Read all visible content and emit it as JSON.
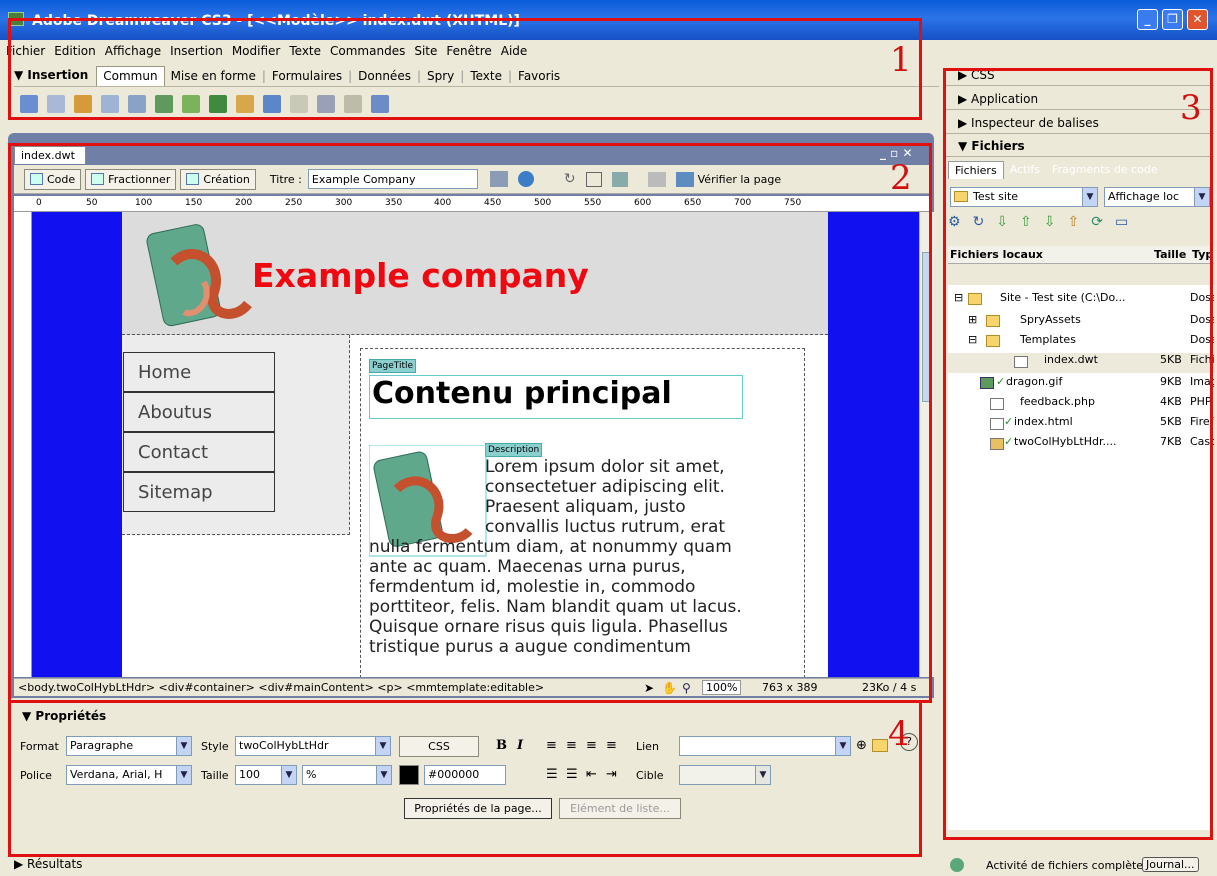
{
  "window": {
    "title": "Adobe Dreamweaver CS3 - [<<Modèle>> index.dwt (XHTML)]"
  },
  "menu": [
    "Fichier",
    "Edition",
    "Affichage",
    "Insertion",
    "Modifier",
    "Texte",
    "Commandes",
    "Site",
    "Fenêtre",
    "Aide"
  ],
  "insert_bar": {
    "title": "▼ Insertion",
    "tabs": [
      "Commun",
      "Mise en forme",
      "Formulaires",
      "Données",
      "Spry",
      "Texte",
      "Favoris"
    ]
  },
  "document": {
    "tab": "index.dwt",
    "toolbar": {
      "code": "Code",
      "split": "Fractionner",
      "design": "Création",
      "title_label": "Titre :",
      "title_value": "Example Company",
      "validate": "Vérifier la page"
    },
    "ruler_ticks": [
      "0",
      "50",
      "100",
      "150",
      "200",
      "250",
      "300",
      "350",
      "400",
      "450",
      "500",
      "550",
      "600",
      "650",
      "700",
      "750"
    ],
    "page": {
      "company": "Example company",
      "nav": [
        "Home",
        "Aboutus",
        "Contact",
        "Sitemap"
      ],
      "pagetitle_tag": "PageTitle",
      "heading": "Contenu principal",
      "description_tag": "Description",
      "body_lines": [
        "Lorem ipsum dolor sit amet,",
        "consectetuer adipiscing elit.",
        "Praesent aliquam, justo",
        "convallis luctus rutrum, erat",
        "nulla fermentum diam, at nonummy quam",
        "ante ac quam. Maecenas urna purus,",
        "fermdentum id, molestie in, commodo",
        "porttiteor, felis. Nam blandit quam ut lacus.",
        "Quisque ornare risus quis ligula. Phasellus",
        "tristique purus a augue condimentum"
      ]
    },
    "status": {
      "tags": "<body.twoColHybLtHdr> <div#container> <div#mainContent> <p> <mmtemplate:editable>",
      "zoom": "100%",
      "size": "763 x 389",
      "weight": "23Ko / 4 s"
    }
  },
  "properties": {
    "title": "▼ Propriétés",
    "format_label": "Format",
    "format_value": "Paragraphe",
    "style_label": "Style",
    "style_value": "twoColHybLtHdr",
    "css_button": "CSS",
    "bold": "B",
    "italic": "I",
    "link_label": "Lien",
    "font_label": "Police",
    "font_value": "Verdana, Arial, H",
    "size_label": "Taille",
    "size_value": "100",
    "unit_value": "%",
    "color_value": "#000000",
    "target_label": "Cible",
    "page_props_button": "Propriétés de la page...",
    "list_item_button": "Elément de liste..."
  },
  "results": "▶ Résultats",
  "panels": {
    "css": "▶ CSS",
    "application": "▶ Application",
    "tag_inspector": "▶ Inspecteur de balises",
    "files": "▼ Fichiers",
    "file_tabs": [
      "Fichiers",
      "Actifs",
      "Fragments de code"
    ],
    "site_value": "Test site",
    "view_value": "Affichage loc",
    "columns": {
      "name": "Fichiers locaux",
      "size": "Taille",
      "type": "Typ"
    },
    "rows": [
      {
        "name": "Site - Test site (C:\\Do...",
        "size": "",
        "type": "Doss"
      },
      {
        "name": "SpryAssets",
        "size": "",
        "type": "Doss"
      },
      {
        "name": "Templates",
        "size": "",
        "type": "Doss"
      },
      {
        "name": "index.dwt",
        "size": "5KB",
        "type": "Fichi"
      },
      {
        "name": "dragon.gif",
        "size": "9KB",
        "type": "Imag"
      },
      {
        "name": "feedback.php",
        "size": "4KB",
        "type": "PHP"
      },
      {
        "name": "index.html",
        "size": "5KB",
        "type": "Firef"
      },
      {
        "name": "twoColHybLtHdr....",
        "size": "7KB",
        "type": "Casc"
      }
    ],
    "status": "Activité de fichiers complète",
    "journal_button": "Journal..."
  },
  "annotations": [
    "1",
    "2",
    "3",
    "4"
  ]
}
